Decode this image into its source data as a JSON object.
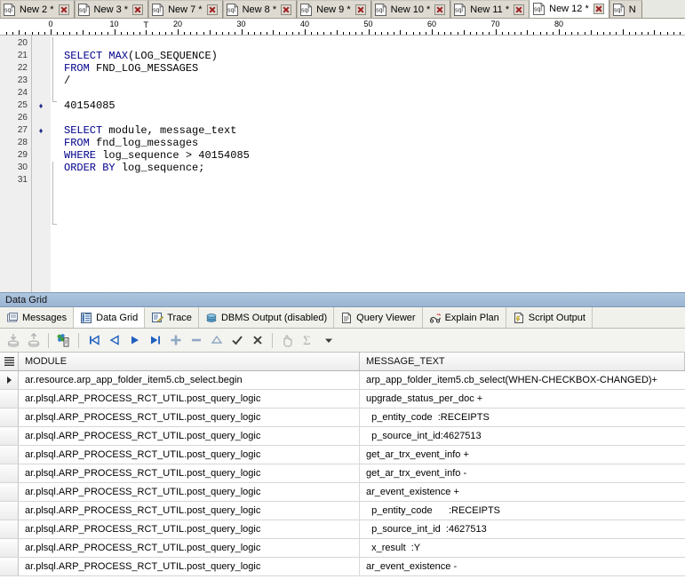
{
  "editor_tabs": [
    {
      "label": "New 2 *",
      "active": false
    },
    {
      "label": "New 3 *",
      "active": false
    },
    {
      "label": "New 7 *",
      "active": false
    },
    {
      "label": "New 8 *",
      "active": false
    },
    {
      "label": "New 9 *",
      "active": false
    },
    {
      "label": "New 10 *",
      "active": false
    },
    {
      "label": "New 11 *",
      "active": false
    },
    {
      "label": "New 12 *",
      "active": true
    },
    {
      "label": "N",
      "active": false
    }
  ],
  "ruler": {
    "numbers": [
      0,
      10,
      20,
      30,
      40,
      50,
      60,
      70,
      80
    ],
    "cursor_marker": "T"
  },
  "editor": {
    "first_line_number": 20,
    "lines": [
      {
        "num": 20,
        "marker": "",
        "tokens": []
      },
      {
        "num": 21,
        "marker": "",
        "tokens": [
          {
            "t": "SELECT ",
            "k": true
          },
          {
            "t": "MAX",
            "k": true
          },
          {
            "t": "(LOG_SEQUENCE)",
            "k": false
          }
        ]
      },
      {
        "num": 22,
        "marker": "",
        "tokens": [
          {
            "t": "FROM ",
            "k": true
          },
          {
            "t": "FND_LOG_MESSAGES",
            "k": false
          }
        ]
      },
      {
        "num": 23,
        "marker": "",
        "tokens": [
          {
            "t": "/",
            "k": false
          }
        ]
      },
      {
        "num": 24,
        "marker": "",
        "tokens": []
      },
      {
        "num": 25,
        "marker": "♦",
        "tokens": [
          {
            "t": "40154085",
            "k": false
          }
        ]
      },
      {
        "num": 26,
        "marker": "",
        "tokens": []
      },
      {
        "num": 27,
        "marker": "♦",
        "tokens": [
          {
            "t": "SELECT ",
            "k": true
          },
          {
            "t": "module, message_text",
            "k": false
          }
        ]
      },
      {
        "num": 28,
        "marker": "",
        "tokens": [
          {
            "t": "FROM ",
            "k": true
          },
          {
            "t": "fnd_log_messages",
            "k": false
          }
        ]
      },
      {
        "num": 29,
        "marker": "",
        "tokens": [
          {
            "t": "WHERE ",
            "k": true
          },
          {
            "t": "log_sequence > 40154085",
            "k": false
          }
        ]
      },
      {
        "num": 30,
        "marker": "",
        "tokens": [
          {
            "t": "ORDER BY ",
            "k": true
          },
          {
            "t": "log_sequence;",
            "k": false
          }
        ]
      },
      {
        "num": 31,
        "marker": "",
        "tokens": []
      }
    ]
  },
  "panel": {
    "title": "Data Grid"
  },
  "result_tabs": [
    {
      "label": "Messages",
      "icon": "messages-icon",
      "active": false
    },
    {
      "label": "Data Grid",
      "icon": "datagrid-icon",
      "active": true
    },
    {
      "label": "Trace",
      "icon": "trace-icon",
      "active": false
    },
    {
      "label": "DBMS Output (disabled)",
      "icon": "dbms-output-icon",
      "active": false
    },
    {
      "label": "Query Viewer",
      "icon": "query-viewer-icon",
      "active": false
    },
    {
      "label": "Explain Plan",
      "icon": "explain-plan-icon",
      "active": false
    },
    {
      "label": "Script Output",
      "icon": "script-output-icon",
      "active": false
    }
  ],
  "grid_toolbar": [
    {
      "name": "import-data-button",
      "glyph": "import",
      "enabled": false
    },
    {
      "name": "export-data-button",
      "glyph": "export",
      "enabled": false
    },
    {
      "name": "separator-1",
      "glyph": "sep",
      "enabled": false
    },
    {
      "name": "copy-to-clipboard-button",
      "glyph": "copy",
      "enabled": true
    },
    {
      "name": "separator-2",
      "glyph": "sep",
      "enabled": false
    },
    {
      "name": "first-record-button",
      "glyph": "first",
      "enabled": true
    },
    {
      "name": "previous-record-button",
      "glyph": "prev",
      "enabled": true
    },
    {
      "name": "next-record-button",
      "glyph": "next",
      "enabled": true
    },
    {
      "name": "last-record-button",
      "glyph": "last",
      "enabled": true
    },
    {
      "name": "insert-record-button",
      "glyph": "plus",
      "enabled": true
    },
    {
      "name": "delete-record-button",
      "glyph": "minus",
      "enabled": true
    },
    {
      "name": "duplicate-record-button",
      "glyph": "up",
      "enabled": true
    },
    {
      "name": "commit-button",
      "glyph": "check",
      "enabled": true
    },
    {
      "name": "rollback-button",
      "glyph": "cross",
      "enabled": true
    },
    {
      "name": "separator-3",
      "glyph": "sep",
      "enabled": false
    },
    {
      "name": "pan-tool-button",
      "glyph": "hand",
      "enabled": false
    },
    {
      "name": "sum-button",
      "glyph": "sigma",
      "enabled": false
    },
    {
      "name": "more-options-button",
      "glyph": "caret",
      "enabled": true
    }
  ],
  "grid": {
    "columns": [
      "MODULE",
      "MESSAGE_TEXT"
    ],
    "selected_row_index": 0,
    "rows": [
      {
        "MODULE": "ar.resource.arp_app_folder_item5.cb_select.begin",
        "MESSAGE_TEXT": "arp_app_folder_item5.cb_select(WHEN-CHECKBOX-CHANGED)+"
      },
      {
        "MODULE": "ar.plsql.ARP_PROCESS_RCT_UTIL.post_query_logic",
        "MESSAGE_TEXT": "upgrade_status_per_doc +"
      },
      {
        "MODULE": "ar.plsql.ARP_PROCESS_RCT_UTIL.post_query_logic",
        "MESSAGE_TEXT": "  p_entity_code  :RECEIPTS"
      },
      {
        "MODULE": "ar.plsql.ARP_PROCESS_RCT_UTIL.post_query_logic",
        "MESSAGE_TEXT": "  p_source_int_id:4627513"
      },
      {
        "MODULE": "ar.plsql.ARP_PROCESS_RCT_UTIL.post_query_logic",
        "MESSAGE_TEXT": "get_ar_trx_event_info +"
      },
      {
        "MODULE": "ar.plsql.ARP_PROCESS_RCT_UTIL.post_query_logic",
        "MESSAGE_TEXT": "get_ar_trx_event_info -"
      },
      {
        "MODULE": "ar.plsql.ARP_PROCESS_RCT_UTIL.post_query_logic",
        "MESSAGE_TEXT": "ar_event_existence +"
      },
      {
        "MODULE": "ar.plsql.ARP_PROCESS_RCT_UTIL.post_query_logic",
        "MESSAGE_TEXT": "  p_entity_code      :RECEIPTS"
      },
      {
        "MODULE": "ar.plsql.ARP_PROCESS_RCT_UTIL.post_query_logic",
        "MESSAGE_TEXT": "  p_source_int_id  :4627513"
      },
      {
        "MODULE": "ar.plsql.ARP_PROCESS_RCT_UTIL.post_query_logic",
        "MESSAGE_TEXT": "  x_result  :Y"
      },
      {
        "MODULE": "ar.plsql.ARP_PROCESS_RCT_UTIL.post_query_logic",
        "MESSAGE_TEXT": "ar_event_existence -"
      }
    ]
  },
  "colors": {
    "keyword": "#00008b",
    "panel_title_bg": "#9ab4d2",
    "tabstrip_bg": "#e8e8e2",
    "gutter_bg": "#efefef",
    "nav_arrow": "#1f5fbf",
    "close_x": "#9e2020"
  }
}
